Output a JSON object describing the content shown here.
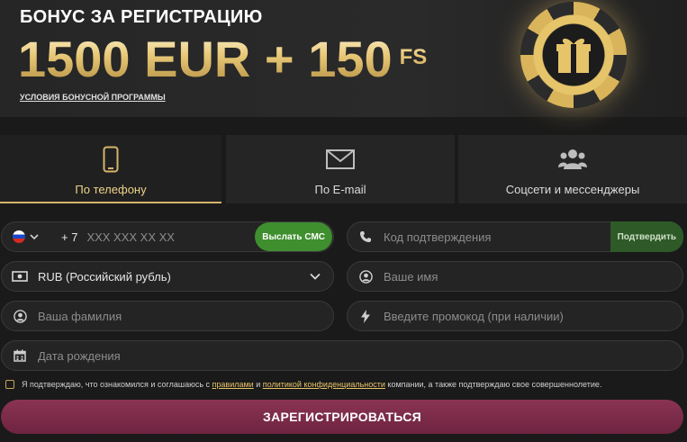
{
  "banner": {
    "title": "БОНУС ЗА РЕГИСТРАЦИЮ",
    "amount": "1500 EUR + 150",
    "amount_suffix": "FS",
    "terms_link": "УСЛОВИЯ БОНУСНОЙ ПРОГРАММЫ"
  },
  "tabs": [
    {
      "label": "По телефону",
      "icon": "phone-icon",
      "active": true
    },
    {
      "label": "По E-mail",
      "icon": "envelope-icon",
      "active": false
    },
    {
      "label": "Соцсети и мессенджеры",
      "icon": "users-icon",
      "active": false
    }
  ],
  "form": {
    "phone": {
      "country": "RU",
      "prefix": "+ 7",
      "placeholder": "XXX XXX XX XX",
      "send_sms_label": "Выслать СМС"
    },
    "code": {
      "placeholder": "Код подтверждения",
      "confirm_label": "Подтвердить"
    },
    "currency": {
      "selected": "RUB (Российский рубль)"
    },
    "first_name": {
      "placeholder": "Ваше имя"
    },
    "last_name": {
      "placeholder": "Ваша фамилия"
    },
    "promo": {
      "placeholder": "Введите промокод (при наличии)"
    },
    "birthdate": {
      "placeholder": "Дата рождения"
    }
  },
  "consent": {
    "text_before": "Я подтверждаю, что ознакомился и соглашаюсь с",
    "rules_link": "правилами",
    "and": "и",
    "privacy_link": "политикой конфиденциальности",
    "text_after": "компании, а также подтверждаю свое совершеннолетие."
  },
  "register_label": "ЗАРЕГИСТРИРОВАТЬСЯ",
  "colors": {
    "accent_gold": "#d6b36a",
    "green_button": "#3f8f2f",
    "register_button": "#7e2c4a",
    "background": "#1a1a1a"
  }
}
